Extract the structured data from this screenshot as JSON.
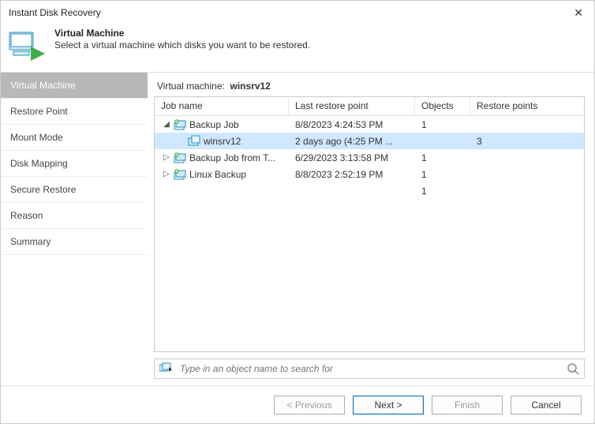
{
  "window": {
    "title": "Instant Disk Recovery"
  },
  "header": {
    "title": "Virtual Machine",
    "subtitle": "Select a virtual machine which disks you want to be restored."
  },
  "sidebar": {
    "items": [
      {
        "label": "Virtual Machine",
        "active": true
      },
      {
        "label": "Restore Point"
      },
      {
        "label": "Mount Mode"
      },
      {
        "label": "Disk Mapping"
      },
      {
        "label": "Secure Restore"
      },
      {
        "label": "Reason"
      },
      {
        "label": "Summary"
      }
    ]
  },
  "main": {
    "vm_label": "Virtual machine:",
    "vm_name": "winsrv12",
    "columns": {
      "name": "Job name",
      "lrp": "Last restore point",
      "objects": "Objects",
      "rp": "Restore points"
    },
    "rows": [
      {
        "indent": 0,
        "expander": "open",
        "icon": "job",
        "name": "Backup Job",
        "lrp": "8/8/2023 4:24:53 PM",
        "objects": "1",
        "rp": "",
        "selected": false
      },
      {
        "indent": 1,
        "expander": "none",
        "icon": "vm",
        "name": "winsrv12",
        "lrp": "2 days ago (4:25 PM ...",
        "objects": "",
        "rp": "3",
        "selected": true
      },
      {
        "indent": 0,
        "expander": "closed",
        "icon": "job",
        "name": "Backup Job from T...",
        "lrp": "6/29/2023 3:13:58 PM",
        "objects": "1",
        "rp": "",
        "selected": false
      },
      {
        "indent": 0,
        "expander": "closed",
        "icon": "job",
        "name": "Linux Backup",
        "lrp": "8/8/2023 2:52:19 PM",
        "objects": "1",
        "rp": "",
        "selected": false
      },
      {
        "indent": 0,
        "expander": "none",
        "icon": "none",
        "name": "",
        "lrp": "",
        "objects": "1",
        "rp": "",
        "selected": false
      }
    ],
    "search": {
      "placeholder": "Type in an object name to search for"
    }
  },
  "footer": {
    "previous": "< Previous",
    "next": "Next >",
    "finish": "Finish",
    "cancel": "Cancel"
  }
}
